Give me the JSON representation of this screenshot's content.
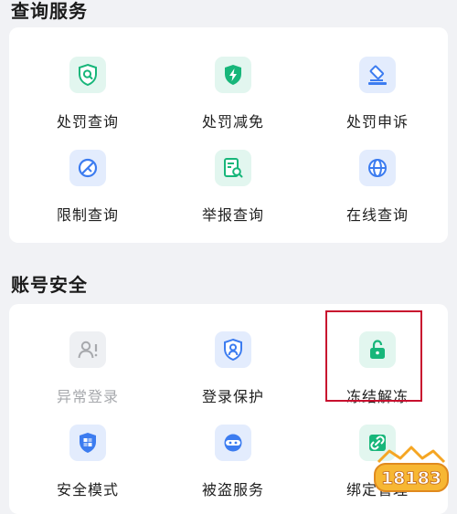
{
  "sections": {
    "query": {
      "title": "查询服务",
      "items": [
        {
          "label": "处罚查询",
          "icon": "shield-search-icon"
        },
        {
          "label": "处罚减免",
          "icon": "shield-lightning-icon"
        },
        {
          "label": "处罚申诉",
          "icon": "gavel-icon"
        },
        {
          "label": "限制查询",
          "icon": "restriction-icon"
        },
        {
          "label": "举报查询",
          "icon": "report-search-icon"
        },
        {
          "label": "在线查询",
          "icon": "globe-icon"
        }
      ]
    },
    "account": {
      "title": "账号安全",
      "items": [
        {
          "label": "异常登录",
          "icon": "user-alert-icon",
          "disabled": true
        },
        {
          "label": "登录保护",
          "icon": "user-shield-icon"
        },
        {
          "label": "冻结解冻",
          "icon": "unlock-icon"
        },
        {
          "label": "安全模式",
          "icon": "shield-grid-icon"
        },
        {
          "label": "被盗服务",
          "icon": "ninja-icon"
        },
        {
          "label": "绑定管理",
          "icon": "link-icon"
        }
      ]
    }
  },
  "watermark": {
    "text": "18183"
  },
  "colors": {
    "accent_blue": "#3c7cf0",
    "accent_green": "#17b67a",
    "highlight_red": "#c8102e",
    "disabled_gray": "#a7a9ad"
  }
}
